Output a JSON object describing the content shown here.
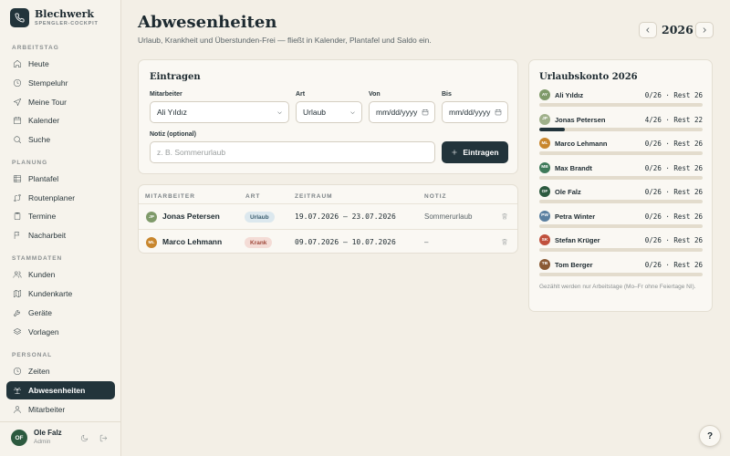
{
  "brand": {
    "name": "Blechwerk",
    "subtitle": "SPENGLER-COCKPIT"
  },
  "sidebar": {
    "sections": [
      {
        "title": "ARBEITSTAG",
        "items": [
          {
            "label": "Heute",
            "icon": "home-icon"
          },
          {
            "label": "Stempeluhr",
            "icon": "clock-icon"
          },
          {
            "label": "Meine Tour",
            "icon": "navigation-icon"
          },
          {
            "label": "Kalender",
            "icon": "calendar-icon"
          },
          {
            "label": "Suche",
            "icon": "search-icon"
          }
        ]
      },
      {
        "title": "PLANUNG",
        "items": [
          {
            "label": "Plantafel",
            "icon": "grid-icon"
          },
          {
            "label": "Routenplaner",
            "icon": "route-icon"
          },
          {
            "label": "Termine",
            "icon": "clipboard-icon"
          },
          {
            "label": "Nacharbeit",
            "icon": "flag-icon"
          }
        ]
      },
      {
        "title": "STAMMDATEN",
        "items": [
          {
            "label": "Kunden",
            "icon": "users-icon"
          },
          {
            "label": "Kundenkarte",
            "icon": "map-icon"
          },
          {
            "label": "Geräte",
            "icon": "wrench-icon"
          },
          {
            "label": "Vorlagen",
            "icon": "layers-icon"
          }
        ]
      },
      {
        "title": "PERSONAL",
        "items": [
          {
            "label": "Zeiten",
            "icon": "clock-icon"
          },
          {
            "label": "Abwesenheiten",
            "icon": "palm-icon",
            "active": true
          },
          {
            "label": "Mitarbeiter",
            "icon": "user-icon"
          }
        ]
      }
    ]
  },
  "user": {
    "initials": "OF",
    "name": "Ole Falz",
    "role": "Admin"
  },
  "header": {
    "title": "Abwesenheiten",
    "subtitle": "Urlaub, Krankheit und Überstunden-Frei — fließt in Kalender, Plantafel und Saldo ein.",
    "year": "2026"
  },
  "form": {
    "title": "Eintragen",
    "employee_label": "Mitarbeiter",
    "employee_value": "Ali Yıldız",
    "type_label": "Art",
    "type_value": "Urlaub",
    "from_label": "Von",
    "from_value": "mm/dd/yyyy",
    "to_label": "Bis",
    "to_value": "mm/dd/yyyy",
    "note_label": "Notiz (optional)",
    "note_placeholder": "z. B. Sommerurlaub",
    "submit_label": "Eintragen"
  },
  "table": {
    "headers": [
      "MITARBEITER",
      "ART",
      "ZEITRAUM",
      "NOTIZ"
    ],
    "rows": [
      {
        "initials": "JP",
        "avatar_color": "#7f9a6a",
        "name": "Jonas Petersen",
        "type": "Urlaub",
        "type_bg": "#dce8ee",
        "type_fg": "#3d5f70",
        "period": "19.07.2026 – 23.07.2026",
        "note": "Sommerurlaub"
      },
      {
        "initials": "ML",
        "avatar_color": "#c8862d",
        "name": "Marco Lehmann",
        "type": "Krank",
        "type_bg": "#f4dcd6",
        "type_fg": "#a04a3c",
        "period": "09.07.2026 – 10.07.2026",
        "note": "–"
      }
    ]
  },
  "account": {
    "title": "Urlaubskonto 2026",
    "entries": [
      {
        "initials": "AY",
        "color": "#7f9a6a",
        "name": "Ali Yıldız",
        "value": "0/26 · Rest 26",
        "used_fraction": 0
      },
      {
        "initials": "JP",
        "color": "#9fb08a",
        "name": "Jonas Petersen",
        "value": "4/26 · Rest 22",
        "used_fraction": 0.154
      },
      {
        "initials": "ML",
        "color": "#c8862d",
        "name": "Marco Lehmann",
        "value": "0/26 · Rest 26",
        "used_fraction": 0
      },
      {
        "initials": "MB",
        "color": "#3f7a5a",
        "name": "Max Brandt",
        "value": "0/26 · Rest 26",
        "used_fraction": 0
      },
      {
        "initials": "OF",
        "color": "#2c5a3f",
        "name": "Ole Falz",
        "value": "0/26 · Rest 26",
        "used_fraction": 0
      },
      {
        "initials": "PW",
        "color": "#5a7fa0",
        "name": "Petra Winter",
        "value": "0/26 · Rest 26",
        "used_fraction": 0
      },
      {
        "initials": "SK",
        "color": "#c0503c",
        "name": "Stefan Krüger",
        "value": "0/26 · Rest 26",
        "used_fraction": 0
      },
      {
        "initials": "TB",
        "color": "#8a5a34",
        "name": "Tom Berger",
        "value": "0/26 · Rest 26",
        "used_fraction": 0
      }
    ],
    "note": "Gezählt werden nur Arbeitstage (Mo–Fr ohne Feiertage NI)."
  },
  "help_label": "?"
}
